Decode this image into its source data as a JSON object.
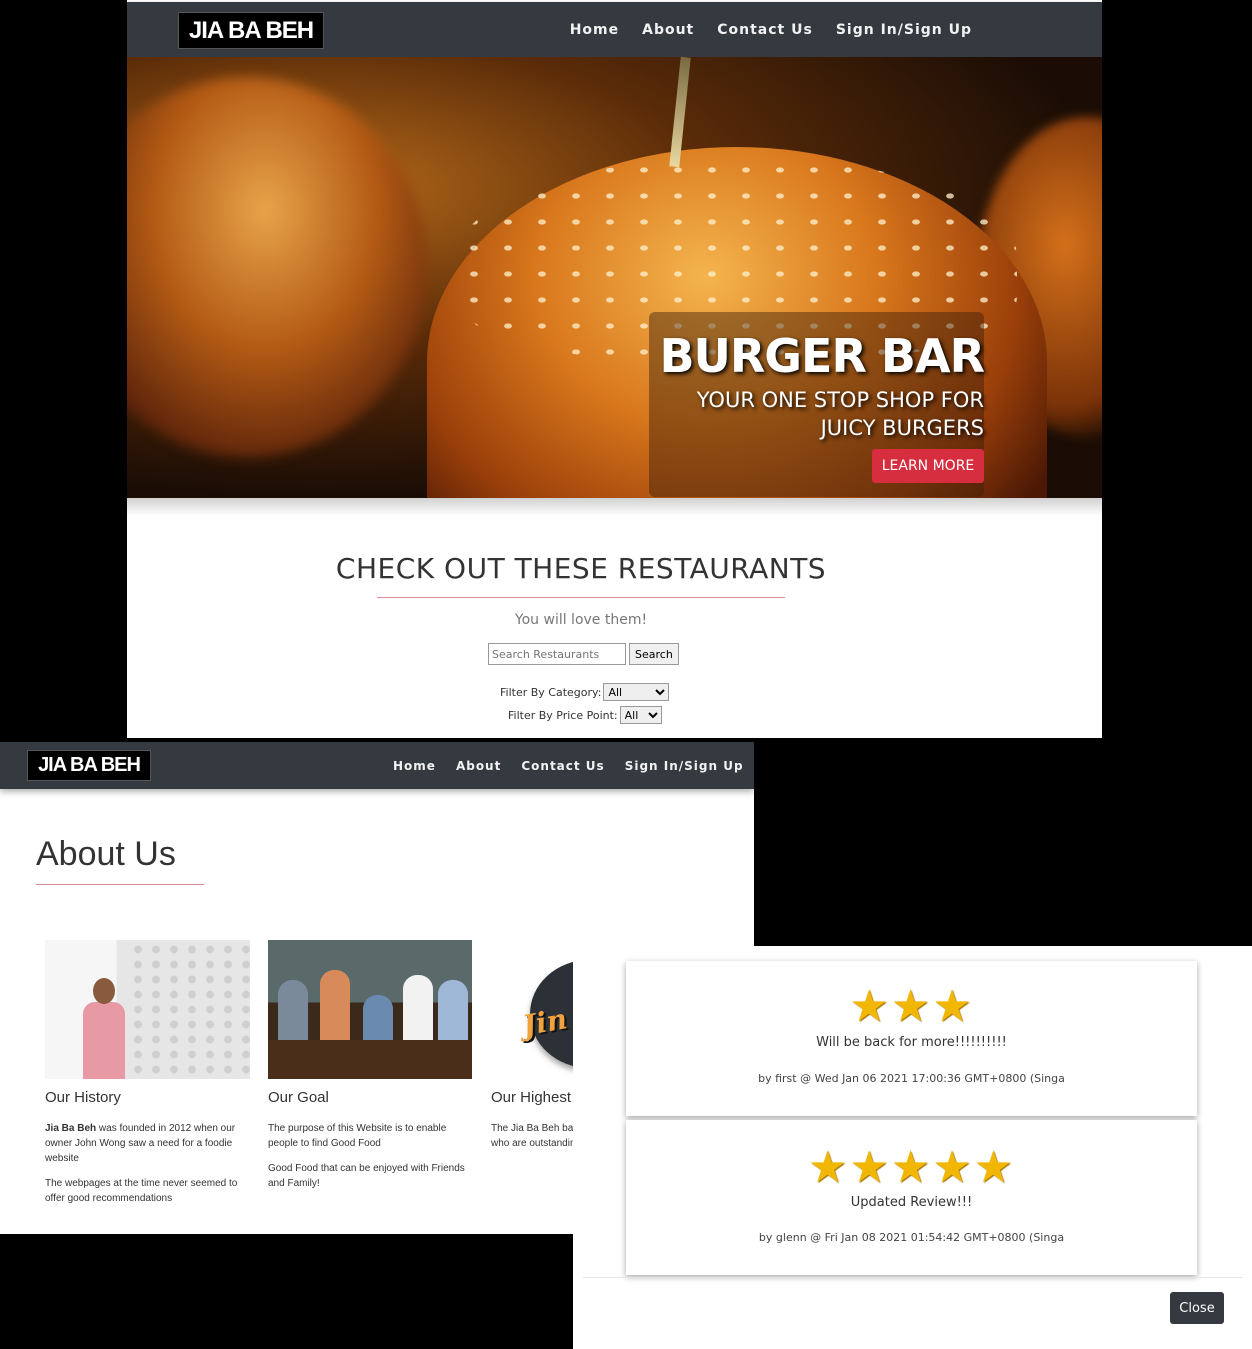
{
  "brand": {
    "logo_text": "JIA BA BEH"
  },
  "home": {
    "nav": [
      "Home",
      "About",
      "Contact Us",
      "Sign In/Sign Up"
    ],
    "hero": {
      "title": "BURGER BAR",
      "subtitle": "YOUR ONE STOP SHOP FOR JUICY BURGERS",
      "button": "LEARN MORE"
    },
    "section_title": "CHECK OUT THESE RESTAURANTS",
    "section_subtitle": "You will love them!",
    "search": {
      "placeholder": "Search Restaurants",
      "button": "Search"
    },
    "filters": {
      "category_label": "Filter By Category:",
      "category_value": "All",
      "price_label": "Filter By Price Point:",
      "price_value": "All"
    },
    "accent_color": "#d62d3f"
  },
  "about": {
    "nav": [
      "Home",
      "About",
      "Contact Us",
      "Sign In/Sign Up"
    ],
    "title": "About Us",
    "cards": [
      {
        "heading": "Our History",
        "bold_lead": "Jia Ba Beh",
        "text1": " was founded in 2012 when our owner John Wong saw a need for a foodie website",
        "text2": "The webpages at the time never seemed to offer good recommendations"
      },
      {
        "heading": "Our Goal",
        "text1": "The purpose of this Website is to enable people to find Good Food",
        "text2": "Good Food that can be enjoyed with Friends and Family!"
      },
      {
        "heading": "Our Highest Award",
        "badge_text": "Jin Swee",
        "text1": "The Jia Ba Beh badge is presented to eateries who are outstanding!"
      }
    ]
  },
  "reviews": {
    "items": [
      {
        "rating": 3,
        "stars": "★★★",
        "text": "Will be back for more!!!!!!!!!!",
        "byline": "by first @ Wed Jan 06 2021 17:00:36 GMT+0800 (Singa"
      },
      {
        "rating": 5,
        "stars": "★★★★★",
        "text": "Updated Review!!!",
        "byline": "by glenn @ Fri Jan 08 2021 01:54:42 GMT+0800 (Singa"
      }
    ],
    "close_button": "Close",
    "star_color": "#f2b705"
  }
}
